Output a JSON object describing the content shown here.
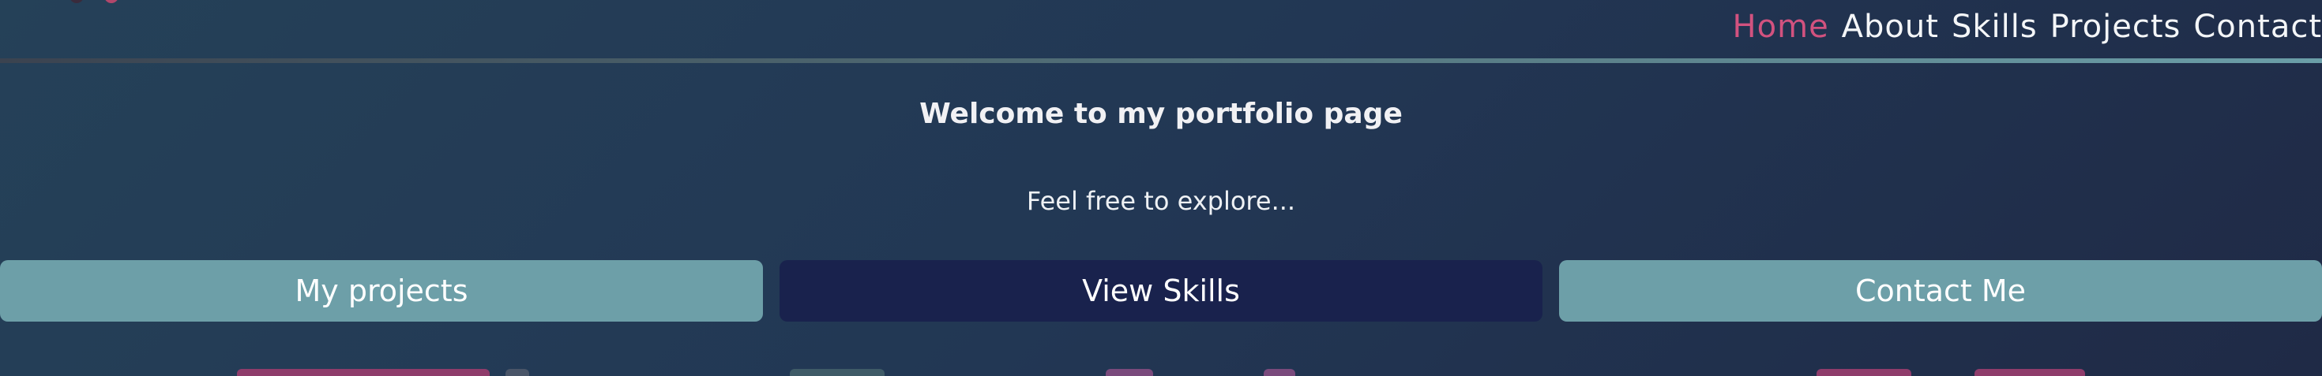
{
  "nav": {
    "links": [
      {
        "label": "Home",
        "active": true
      },
      {
        "label": "About",
        "active": false
      },
      {
        "label": "Skills",
        "active": false
      },
      {
        "label": "Projects",
        "active": false
      },
      {
        "label": "Contact",
        "active": false
      }
    ]
  },
  "hero": {
    "title": "Welcome to my portfolio page",
    "subtitle": "Feel free to explore..."
  },
  "buttons": {
    "projects": "My projects",
    "skills": "View Skills",
    "contact": "Contact Me"
  },
  "colors": {
    "accent": "#d2527f",
    "button_primary": "#6d9fa8",
    "button_dark": "#19224d",
    "background": "#223754"
  }
}
